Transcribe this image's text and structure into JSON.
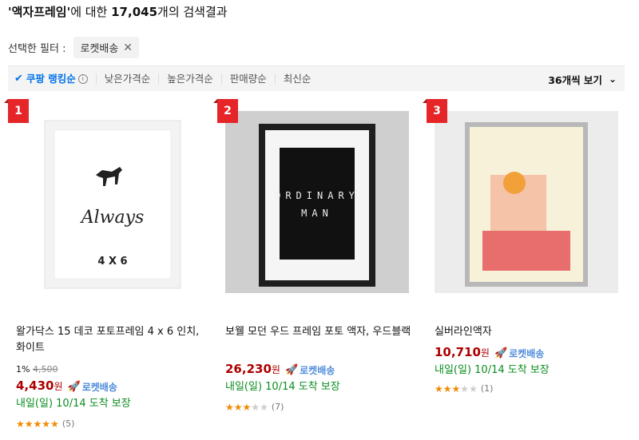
{
  "header": {
    "query": "'액자프레임'",
    "mid": "에 대한 ",
    "count": "17,045",
    "suffix": "개의 검색결과"
  },
  "filter": {
    "label": "선택한 필터 :",
    "chip": "로켓배송"
  },
  "sort": {
    "items": [
      "쿠팡 랭킹순",
      "낮은가격순",
      "높은가격순",
      "판매량순",
      "최신순"
    ],
    "per_page": "36개씩 보기"
  },
  "products": [
    {
      "rank": "1",
      "name": "왈가닥스 15 데코 포토프레임 4 x 6 인치, 화이트",
      "discount_rate": "1%",
      "original_price": "4,500",
      "price": "4,430",
      "won": "원",
      "rocket": "로켓배송",
      "arrival": "내일(일) 10/14 도착 보장",
      "rating": 4.5,
      "review_count": "(5)",
      "thumb_text": [
        "Always",
        "4 X 6"
      ]
    },
    {
      "rank": "2",
      "name": "보웰 모던 우드 프레임 포토 액자, 우드블랙",
      "price": "26,230",
      "won": "원",
      "rocket": "로켓배송",
      "arrival": "내일(일) 10/14 도착 보장",
      "rating": 3.5,
      "review_count": "(7)",
      "thumb_text": [
        "ORDINARY",
        "MAN"
      ]
    },
    {
      "rank": "3",
      "name": "실버라인액자",
      "price": "10,710",
      "won": "원",
      "rocket": "로켓배송",
      "arrival": "내일(일) 10/14 도착 보장",
      "rating": 3,
      "review_count": "(1)"
    }
  ],
  "colors": {
    "accent": "#0073e9",
    "price": "#ae0000",
    "arrival": "#0a8d1f",
    "rank": "#e52528",
    "star": "#f28a00"
  }
}
